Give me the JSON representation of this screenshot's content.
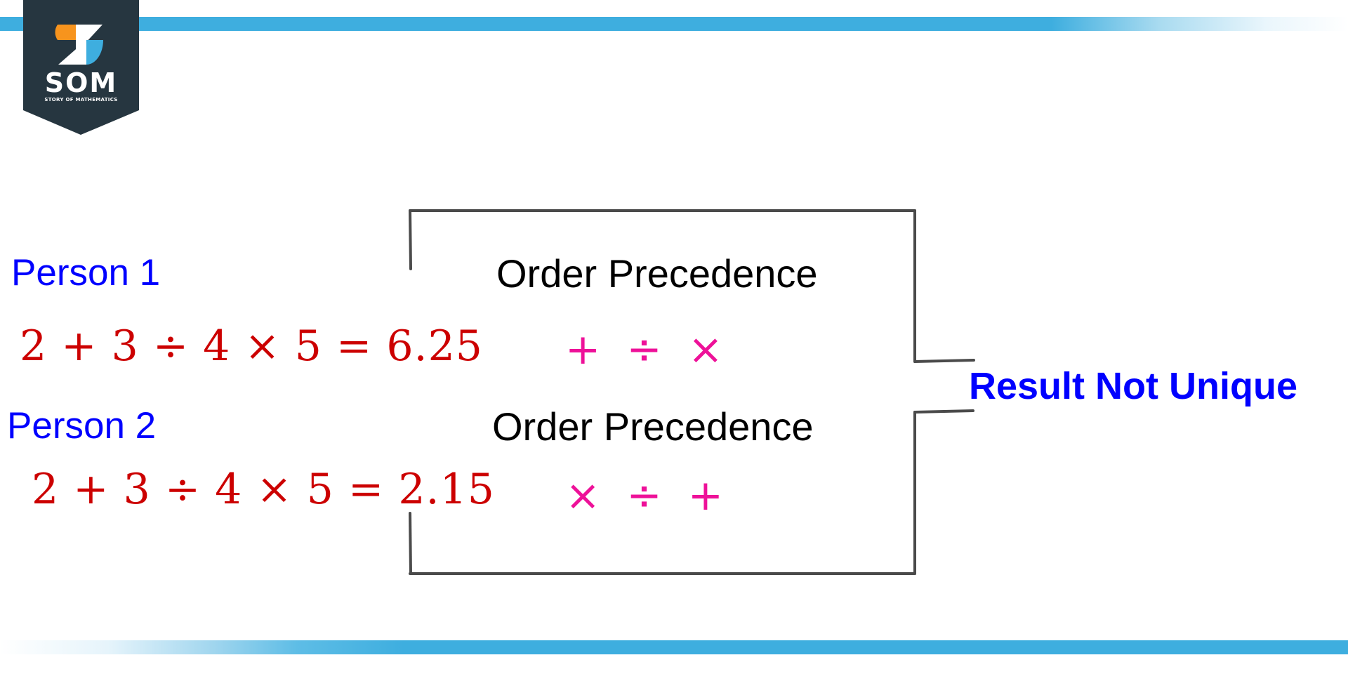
{
  "logo": {
    "main_text": "SOM",
    "sub_text": "STORY OF MATHEMATICS",
    "icon": "som-logo-icon",
    "colors": {
      "background": "#263640",
      "orange": "#f7941d",
      "blue": "#3eaedf"
    }
  },
  "person1": {
    "label": "Person 1",
    "equation": "2 + 3 ÷ 4 × 5 = 6.25"
  },
  "person2": {
    "label": "Person 2",
    "equation": "2 + 3 ÷ 4 × 5 = 2.15"
  },
  "precedence1": {
    "title": "Order Precedence",
    "operators": "+  ÷ ×"
  },
  "precedence2": {
    "title": "Order Precedence",
    "operators": "×  ÷ +"
  },
  "result": {
    "label": "Result Not Unique"
  },
  "colors": {
    "label": "#0000ff",
    "equation": "#cc0000",
    "operators": "#ee1199",
    "frame": "#4a4a4a",
    "accent_bar": "#3eaedf"
  }
}
